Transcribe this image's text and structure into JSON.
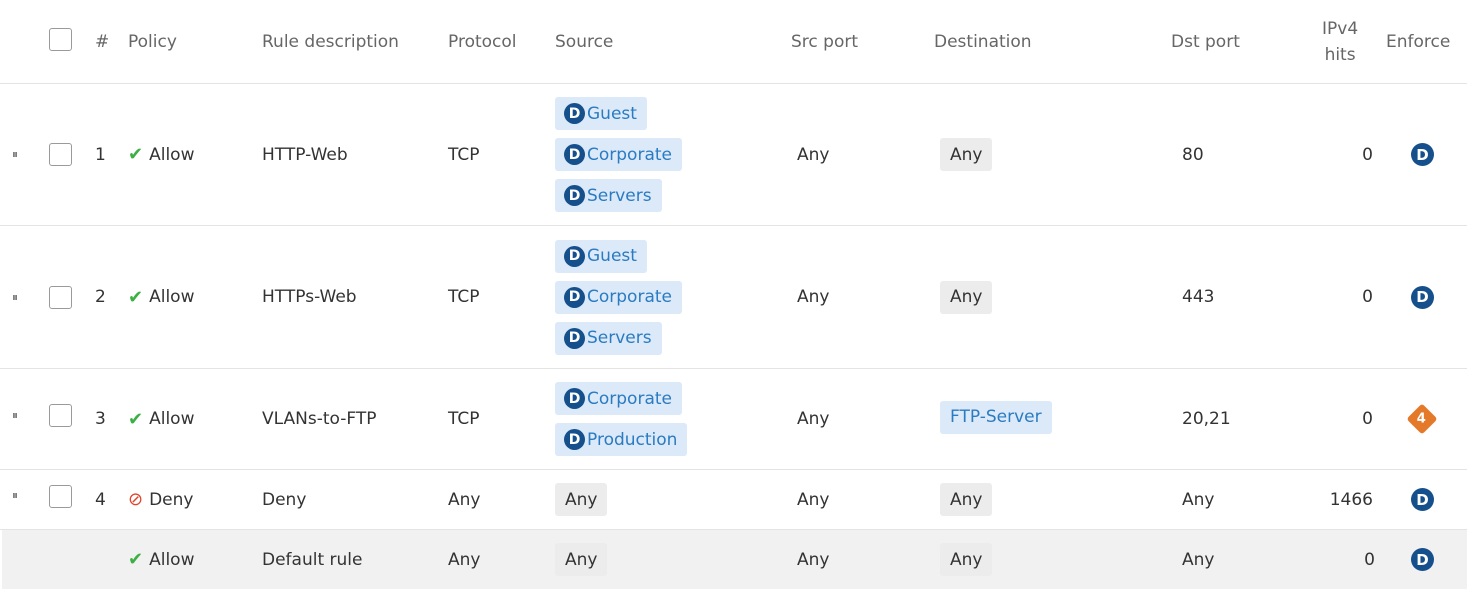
{
  "header": {
    "num": "#",
    "policy": "Policy",
    "description": "Rule description",
    "protocol": "Protocol",
    "source": "Source",
    "src_port": "Src port",
    "destination": "Destination",
    "dst_port": "Dst port",
    "hits_line1": "IPv4",
    "hits_line2": "hits",
    "enforce": "Enforce"
  },
  "icons": {
    "handle": "⏸",
    "allow": "✔",
    "deny": "⊘",
    "group_badge": "D",
    "enforce_badge": "D",
    "warning_badge": "4"
  },
  "rules": [
    {
      "num": "1",
      "policy": "Allow",
      "description": "HTTP-Web",
      "protocol": "TCP",
      "sources": [
        "Guest",
        "Corporate",
        "Servers"
      ],
      "src_port": "Any",
      "destination": "Any",
      "dst_port": "80",
      "hits": "0"
    },
    {
      "num": "2",
      "policy": "Allow",
      "description": "HTTPs-Web",
      "protocol": "TCP",
      "sources": [
        "Guest",
        "Corporate",
        "Servers"
      ],
      "src_port": "Any",
      "destination": "Any",
      "dst_port": "443",
      "hits": "0"
    },
    {
      "num": "3",
      "policy": "Allow",
      "description": "VLANs-to-FTP",
      "protocol": "TCP",
      "sources": [
        "Corporate",
        "Production"
      ],
      "src_port": "Any",
      "destination": "FTP-Server",
      "dst_port": "20,21",
      "hits": "0"
    },
    {
      "num": "4",
      "policy": "Deny",
      "description": "Deny",
      "protocol": "Any",
      "source": "Any",
      "src_port": "Any",
      "destination": "Any",
      "dst_port": "Any",
      "hits": "1466"
    }
  ],
  "default_rule": {
    "policy": "Allow",
    "description": "Default rule",
    "protocol": "Any",
    "source": "Any",
    "src_port": "Any",
    "destination": "Any",
    "dst_port": "Any",
    "hits": "0"
  },
  "colors": {
    "allow": "#3cb043",
    "deny": "#e0452b",
    "badge": "#154f8c",
    "tag_bg": "#dbe9f8",
    "tag_text": "#2a7bc2",
    "warning": "#e5792a"
  }
}
